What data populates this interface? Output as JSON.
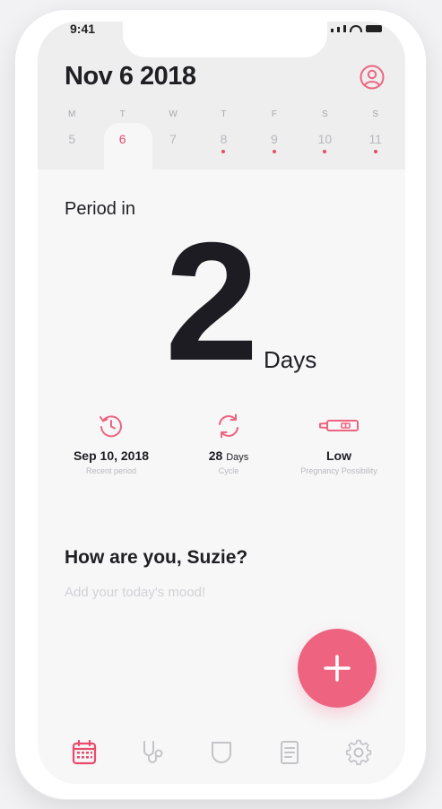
{
  "status": {
    "time": "9:41"
  },
  "header": {
    "date_title": "Nov 6 2018",
    "profile_icon": "user-circle-icon"
  },
  "week": [
    {
      "name": "M",
      "num": "5",
      "active": false,
      "dot": false
    },
    {
      "name": "T",
      "num": "6",
      "active": true,
      "dot": false
    },
    {
      "name": "W",
      "num": "7",
      "active": false,
      "dot": false
    },
    {
      "name": "T",
      "num": "8",
      "active": false,
      "dot": true
    },
    {
      "name": "F",
      "num": "9",
      "active": false,
      "dot": true
    },
    {
      "name": "S",
      "num": "10",
      "active": false,
      "dot": true
    },
    {
      "name": "S",
      "num": "11",
      "active": false,
      "dot": true
    }
  ],
  "period": {
    "label": "Period in",
    "count": "2",
    "unit": "Days"
  },
  "stats": [
    {
      "icon": "history-clock-icon",
      "value": "Sep 10, 2018",
      "unit": "",
      "label": "Recent period"
    },
    {
      "icon": "refresh-cycle-icon",
      "value": "28",
      "unit": "Days",
      "label": "Cycle"
    },
    {
      "icon": "pregnancy-test-icon",
      "value": "Low",
      "unit": "",
      "label": "Pregnancy Possibility"
    }
  ],
  "mood": {
    "greeting": "How are you, Suzie?",
    "placeholder": "Add your today's mood!"
  },
  "fab": {
    "icon": "plus-icon"
  },
  "nav": [
    {
      "icon": "calendar-icon",
      "active": true
    },
    {
      "icon": "stethoscope-icon",
      "active": false
    },
    {
      "icon": "pad-icon",
      "active": false
    },
    {
      "icon": "notes-icon",
      "active": false
    },
    {
      "icon": "gear-icon",
      "active": false
    }
  ],
  "colors": {
    "accent": "#ee6480",
    "accent_dark": "#ea4a6a",
    "text": "#1f1f24",
    "muted": "#b9b9be",
    "nav_inactive": "#c4c4c8"
  }
}
